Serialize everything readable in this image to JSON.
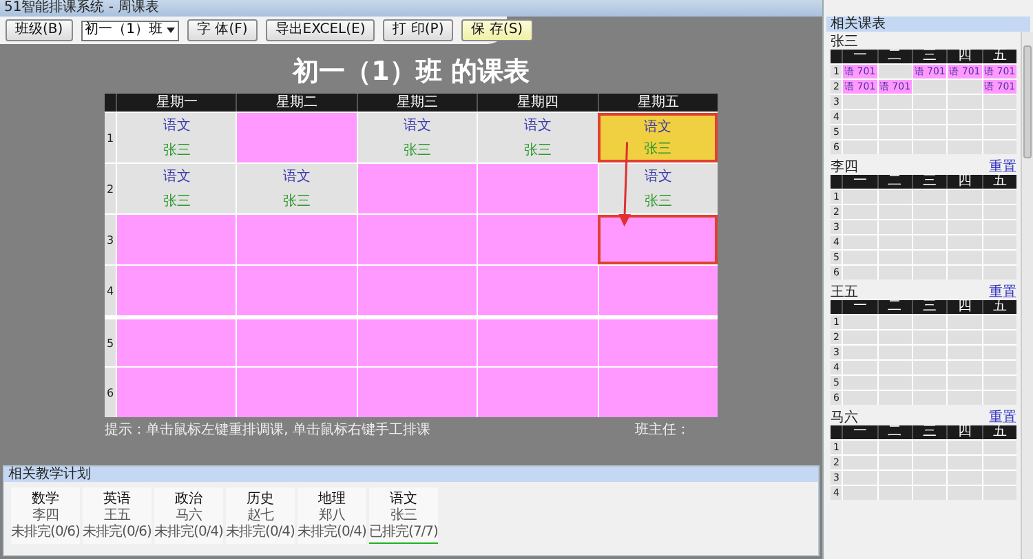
{
  "window": {
    "title": "51智能排课系统 - 周课表"
  },
  "toolbar": {
    "class_button": "班级(B)",
    "class_select": "初一（1）班",
    "buttons": [
      {
        "label": "字 体(F)",
        "kind": "plain"
      },
      {
        "label": "导出EXCEL(E)",
        "kind": "plain"
      },
      {
        "label": "打 印(P)",
        "kind": "plain"
      },
      {
        "label": "保 存(S)",
        "kind": "primary"
      }
    ]
  },
  "timetable": {
    "title": "初一（1）班 的课表",
    "columns": [
      "星期一",
      "星期二",
      "星期三",
      "星期四",
      "星期五"
    ],
    "rows": [
      {
        "label": "1",
        "cells": [
          {
            "kind": "lesson",
            "subject": "语文",
            "teacher": "张三",
            "selected": false,
            "drop_target": false
          },
          {
            "kind": "empty",
            "selected": false,
            "drop_target": false
          },
          {
            "kind": "lesson",
            "subject": "语文",
            "teacher": "张三",
            "selected": false,
            "drop_target": false
          },
          {
            "kind": "lesson",
            "subject": "语文",
            "teacher": "张三",
            "selected": false,
            "drop_target": false
          },
          {
            "kind": "lesson",
            "subject": "语文",
            "teacher": "张三",
            "selected": true,
            "drop_target": false
          }
        ]
      },
      {
        "label": "2",
        "cells": [
          {
            "kind": "lesson",
            "subject": "语文",
            "teacher": "张三",
            "selected": false,
            "drop_target": false
          },
          {
            "kind": "lesson",
            "subject": "语文",
            "teacher": "张三",
            "selected": false,
            "drop_target": false
          },
          {
            "kind": "empty",
            "selected": false,
            "drop_target": false
          },
          {
            "kind": "empty",
            "selected": false,
            "drop_target": false
          },
          {
            "kind": "lesson",
            "subject": "语文",
            "teacher": "张三",
            "selected": false,
            "drop_target": false
          }
        ]
      },
      {
        "label": "3",
        "cells": [
          {
            "kind": "empty",
            "selected": false,
            "drop_target": false
          },
          {
            "kind": "empty",
            "selected": false,
            "drop_target": false
          },
          {
            "kind": "empty",
            "selected": false,
            "drop_target": false
          },
          {
            "kind": "empty",
            "selected": false,
            "drop_target": false
          },
          {
            "kind": "empty",
            "selected": false,
            "drop_target": true
          }
        ]
      },
      {
        "label": "4",
        "cells": [
          {
            "kind": "empty",
            "selected": false,
            "drop_target": false
          },
          {
            "kind": "empty",
            "selected": false,
            "drop_target": false
          },
          {
            "kind": "empty",
            "selected": false,
            "drop_target": false
          },
          {
            "kind": "empty",
            "selected": false,
            "drop_target": false
          },
          {
            "kind": "empty",
            "selected": false,
            "drop_target": false
          }
        ]
      },
      {
        "label": "5",
        "cells": [
          {
            "kind": "empty",
            "selected": false,
            "drop_target": false
          },
          {
            "kind": "empty",
            "selected": false,
            "drop_target": false
          },
          {
            "kind": "empty",
            "selected": false,
            "drop_target": false
          },
          {
            "kind": "empty",
            "selected": false,
            "drop_target": false
          },
          {
            "kind": "empty",
            "selected": false,
            "drop_target": false
          }
        ]
      },
      {
        "label": "6",
        "cells": [
          {
            "kind": "empty",
            "selected": false,
            "drop_target": false
          },
          {
            "kind": "empty",
            "selected": false,
            "drop_target": false
          },
          {
            "kind": "empty",
            "selected": false,
            "drop_target": false
          },
          {
            "kind": "empty",
            "selected": false,
            "drop_target": false
          },
          {
            "kind": "empty",
            "selected": false,
            "drop_target": false
          }
        ]
      }
    ],
    "hint": "提示：单击鼠标左键重排调课, 单击鼠标右键手工排课",
    "head_teacher_label": "班主任："
  },
  "teaching_plan": {
    "title": "相关教学计划",
    "items": [
      {
        "subject": "数学",
        "teacher": "李四",
        "status": "未排完(0/6)",
        "done": false
      },
      {
        "subject": "英语",
        "teacher": "王五",
        "status": "未排完(0/6)",
        "done": false
      },
      {
        "subject": "政治",
        "teacher": "马六",
        "status": "未排完(0/4)",
        "done": false
      },
      {
        "subject": "历史",
        "teacher": "赵七",
        "status": "未排完(0/4)",
        "done": false
      },
      {
        "subject": "地理",
        "teacher": "郑八",
        "status": "未排完(0/4)",
        "done": false
      },
      {
        "subject": "语文",
        "teacher": "张三",
        "status": "已排完(7/7)",
        "done": true
      }
    ]
  },
  "related_timetables": {
    "title": "相关课表",
    "teachers": [
      {
        "name": "张三",
        "columns": [
          "一",
          "二",
          "三",
          "四",
          "五"
        ],
        "rows": [
          {
            "label": "1",
            "cells": [
              {
                "subject": "语",
                "room": "701"
              },
              null,
              {
                "subject": "语",
                "room": "701"
              },
              {
                "subject": "语",
                "room": "701"
              },
              {
                "subject": "语",
                "room": "701"
              }
            ]
          },
          {
            "label": "2",
            "cells": [
              {
                "subject": "语",
                "room": "701"
              },
              {
                "subject": "语",
                "room": "701"
              },
              null,
              null,
              {
                "subject": "语",
                "room": "701"
              }
            ]
          },
          {
            "label": "3",
            "cells": [
              null,
              null,
              null,
              null,
              null
            ]
          },
          {
            "label": "4",
            "cells": [
              null,
              null,
              null,
              null,
              null
            ]
          },
          {
            "label": "5",
            "cells": [
              null,
              null,
              null,
              null,
              null
            ]
          },
          {
            "label": "6",
            "cells": [
              null,
              null,
              null,
              null,
              null
            ]
          }
        ]
      },
      {
        "name": "李四",
        "reset": "重置",
        "columns": [
          "一",
          "二",
          "三",
          "四",
          "五"
        ],
        "rows": [
          {
            "label": "1",
            "cells": [
              null,
              null,
              null,
              null,
              null
            ]
          },
          {
            "label": "2",
            "cells": [
              null,
              null,
              null,
              null,
              null
            ]
          },
          {
            "label": "3",
            "cells": [
              null,
              null,
              null,
              null,
              null
            ]
          },
          {
            "label": "4",
            "cells": [
              null,
              null,
              null,
              null,
              null
            ]
          },
          {
            "label": "5",
            "cells": [
              null,
              null,
              null,
              null,
              null
            ]
          },
          {
            "label": "6",
            "cells": [
              null,
              null,
              null,
              null,
              null
            ]
          }
        ]
      },
      {
        "name": "王五",
        "reset": "重置",
        "columns": [
          "一",
          "二",
          "三",
          "四",
          "五"
        ],
        "rows": [
          {
            "label": "1",
            "cells": [
              null,
              null,
              null,
              null,
              null
            ]
          },
          {
            "label": "2",
            "cells": [
              null,
              null,
              null,
              null,
              null
            ]
          },
          {
            "label": "3",
            "cells": [
              null,
              null,
              null,
              null,
              null
            ]
          },
          {
            "label": "4",
            "cells": [
              null,
              null,
              null,
              null,
              null
            ]
          },
          {
            "label": "5",
            "cells": [
              null,
              null,
              null,
              null,
              null
            ]
          },
          {
            "label": "6",
            "cells": [
              null,
              null,
              null,
              null,
              null
            ]
          }
        ]
      },
      {
        "name": "马六",
        "reset": "重置",
        "columns": [
          "一",
          "二",
          "三",
          "四",
          "五"
        ],
        "rows": [
          {
            "label": "1",
            "cells": [
              null,
              null,
              null,
              null,
              null
            ]
          },
          {
            "label": "2",
            "cells": [
              null,
              null,
              null,
              null,
              null
            ]
          },
          {
            "label": "3",
            "cells": [
              null,
              null,
              null,
              null,
              null
            ]
          },
          {
            "label": "4",
            "cells": [
              null,
              null,
              null,
              null,
              null
            ]
          }
        ]
      }
    ]
  }
}
